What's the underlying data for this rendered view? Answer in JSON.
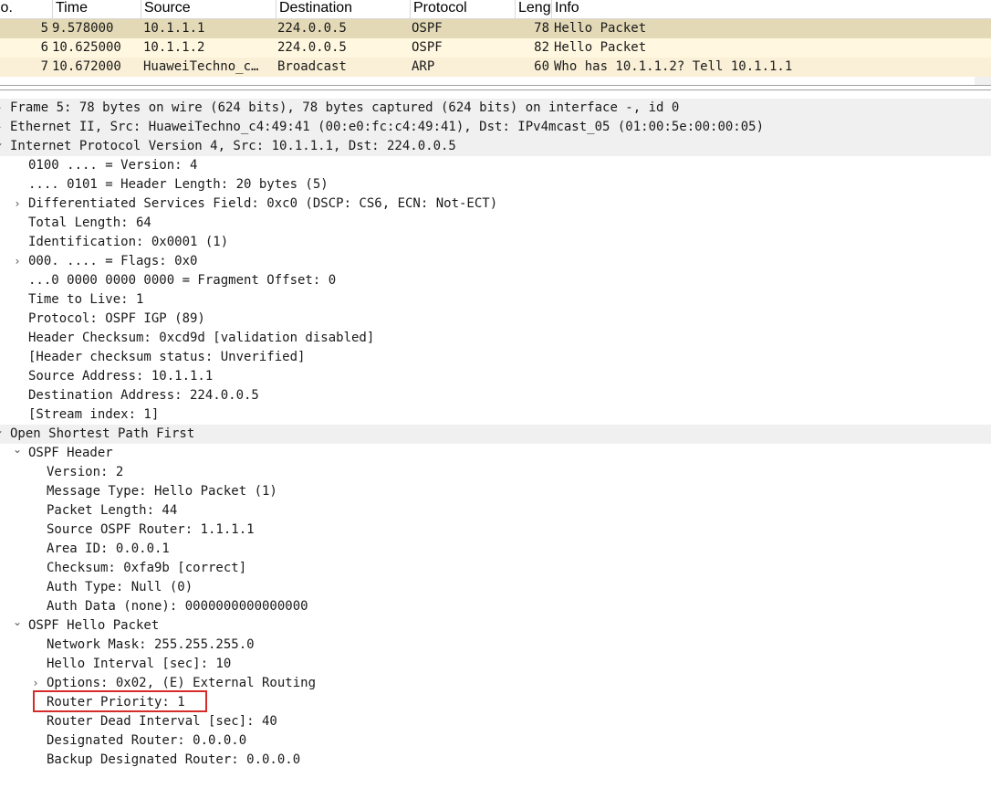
{
  "packet_list": {
    "columns": [
      "No.",
      "Time",
      "Source",
      "Destination",
      "Protocol",
      "Length",
      "Info"
    ],
    "rows": [
      {
        "no": "5",
        "time": "9.578000",
        "source": "10.1.1.1",
        "destination": "224.0.0.5",
        "protocol": "OSPF",
        "length": "78",
        "info": "Hello Packet",
        "bg": "#e3d9b6"
      },
      {
        "no": "6",
        "time": "10.625000",
        "source": "10.1.1.2",
        "destination": "224.0.0.5",
        "protocol": "OSPF",
        "length": "82",
        "info": "Hello Packet",
        "bg": "#fff7df"
      },
      {
        "no": "7",
        "time": "10.672000",
        "source": "HuaweiTechno_c…",
        "destination": "Broadcast",
        "protocol": "ARP",
        "length": "60",
        "info": "Who has 10.1.1.2? Tell 10.1.1.1",
        "bg": "#faf0d7"
      }
    ]
  },
  "details": {
    "lines": [
      {
        "text": "Frame 5: 78 bytes on wire (624 bits), 78 bytes captured (624 bits) on interface -, id 0",
        "level": 0,
        "arrow": "collapsed",
        "top": true
      },
      {
        "text": "Ethernet II, Src: HuaweiTechno_c4:49:41 (00:e0:fc:c4:49:41), Dst: IPv4mcast_05 (01:00:5e:00:00:05)",
        "level": 0,
        "arrow": "collapsed",
        "top": true
      },
      {
        "text": "Internet Protocol Version 4, Src: 10.1.1.1, Dst: 224.0.0.5",
        "level": 0,
        "arrow": "expanded",
        "top": true
      },
      {
        "text": "0100 .... = Version: 4",
        "level": 1,
        "arrow": "none"
      },
      {
        "text": ".... 0101 = Header Length: 20 bytes (5)",
        "level": 1,
        "arrow": "none"
      },
      {
        "text": "Differentiated Services Field: 0xc0 (DSCP: CS6, ECN: Not-ECT)",
        "level": 1,
        "arrow": "collapsed"
      },
      {
        "text": "Total Length: 64",
        "level": 1,
        "arrow": "none"
      },
      {
        "text": "Identification: 0x0001 (1)",
        "level": 1,
        "arrow": "none"
      },
      {
        "text": "000. .... = Flags: 0x0",
        "level": 1,
        "arrow": "collapsed"
      },
      {
        "text": "...0 0000 0000 0000 = Fragment Offset: 0",
        "level": 1,
        "arrow": "none"
      },
      {
        "text": "Time to Live: 1",
        "level": 1,
        "arrow": "none"
      },
      {
        "text": "Protocol: OSPF IGP (89)",
        "level": 1,
        "arrow": "none"
      },
      {
        "text": "Header Checksum: 0xcd9d [validation disabled]",
        "level": 1,
        "arrow": "none"
      },
      {
        "text": "[Header checksum status: Unverified]",
        "level": 1,
        "arrow": "none"
      },
      {
        "text": "Source Address: 10.1.1.1",
        "level": 1,
        "arrow": "none"
      },
      {
        "text": "Destination Address: 224.0.0.5",
        "level": 1,
        "arrow": "none"
      },
      {
        "text": "[Stream index: 1]",
        "level": 1,
        "arrow": "none"
      },
      {
        "text": "Open Shortest Path First",
        "level": 0,
        "arrow": "expanded",
        "top": true
      },
      {
        "text": "OSPF Header",
        "level": 1,
        "arrow": "expanded"
      },
      {
        "text": "Version: 2",
        "level": 2,
        "arrow": "none"
      },
      {
        "text": "Message Type: Hello Packet (1)",
        "level": 2,
        "arrow": "none"
      },
      {
        "text": "Packet Length: 44",
        "level": 2,
        "arrow": "none"
      },
      {
        "text": "Source OSPF Router: 1.1.1.1",
        "level": 2,
        "arrow": "none"
      },
      {
        "text": "Area ID: 0.0.0.1",
        "level": 2,
        "arrow": "none"
      },
      {
        "text": "Checksum: 0xfa9b [correct]",
        "level": 2,
        "arrow": "none"
      },
      {
        "text": "Auth Type: Null (0)",
        "level": 2,
        "arrow": "none"
      },
      {
        "text": "Auth Data (none): 0000000000000000",
        "level": 2,
        "arrow": "none"
      },
      {
        "text": "OSPF Hello Packet",
        "level": 1,
        "arrow": "expanded"
      },
      {
        "text": "Network Mask: 255.255.255.0",
        "level": 2,
        "arrow": "none"
      },
      {
        "text": "Hello Interval [sec]: 10",
        "level": 2,
        "arrow": "none"
      },
      {
        "text": "Options: 0x02, (E) External Routing",
        "level": 2,
        "arrow": "collapsed"
      },
      {
        "text": "Router Priority: 1",
        "level": 2,
        "arrow": "none",
        "highlight": true
      },
      {
        "text": "Router Dead Interval [sec]: 40",
        "level": 2,
        "arrow": "none"
      },
      {
        "text": "Designated Router: 0.0.0.0",
        "level": 2,
        "arrow": "none"
      },
      {
        "text": "Backup Designated Router: 0.0.0.0",
        "level": 2,
        "arrow": "none"
      }
    ]
  },
  "icons": {
    "collapsed": "chevron-right-icon",
    "expanded": "chevron-down-icon"
  },
  "colors": {
    "selected_row": "#e3d9b6",
    "row_alt": "#fff7df",
    "highlight_box": "#d62b2b"
  }
}
